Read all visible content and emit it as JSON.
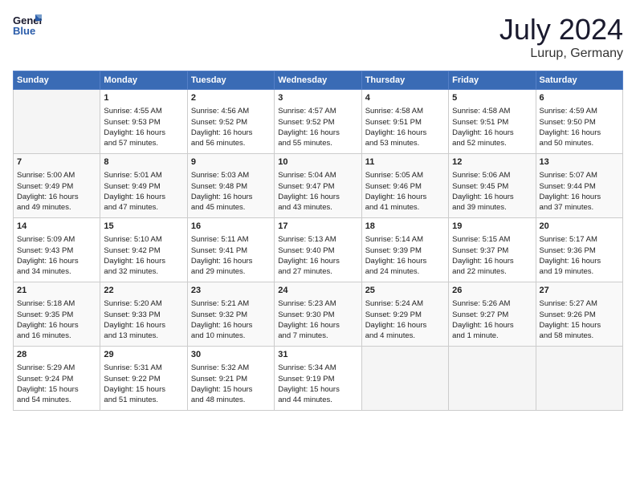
{
  "header": {
    "logo_line1": "General",
    "logo_line2": "Blue",
    "month_year": "July 2024",
    "location": "Lurup, Germany"
  },
  "days_of_week": [
    "Sunday",
    "Monday",
    "Tuesday",
    "Wednesday",
    "Thursday",
    "Friday",
    "Saturday"
  ],
  "weeks": [
    [
      {
        "day": "",
        "info": ""
      },
      {
        "day": "1",
        "info": "Sunrise: 4:55 AM\nSunset: 9:53 PM\nDaylight: 16 hours\nand 57 minutes."
      },
      {
        "day": "2",
        "info": "Sunrise: 4:56 AM\nSunset: 9:52 PM\nDaylight: 16 hours\nand 56 minutes."
      },
      {
        "day": "3",
        "info": "Sunrise: 4:57 AM\nSunset: 9:52 PM\nDaylight: 16 hours\nand 55 minutes."
      },
      {
        "day": "4",
        "info": "Sunrise: 4:58 AM\nSunset: 9:51 PM\nDaylight: 16 hours\nand 53 minutes."
      },
      {
        "day": "5",
        "info": "Sunrise: 4:58 AM\nSunset: 9:51 PM\nDaylight: 16 hours\nand 52 minutes."
      },
      {
        "day": "6",
        "info": "Sunrise: 4:59 AM\nSunset: 9:50 PM\nDaylight: 16 hours\nand 50 minutes."
      }
    ],
    [
      {
        "day": "7",
        "info": "Sunrise: 5:00 AM\nSunset: 9:49 PM\nDaylight: 16 hours\nand 49 minutes."
      },
      {
        "day": "8",
        "info": "Sunrise: 5:01 AM\nSunset: 9:49 PM\nDaylight: 16 hours\nand 47 minutes."
      },
      {
        "day": "9",
        "info": "Sunrise: 5:03 AM\nSunset: 9:48 PM\nDaylight: 16 hours\nand 45 minutes."
      },
      {
        "day": "10",
        "info": "Sunrise: 5:04 AM\nSunset: 9:47 PM\nDaylight: 16 hours\nand 43 minutes."
      },
      {
        "day": "11",
        "info": "Sunrise: 5:05 AM\nSunset: 9:46 PM\nDaylight: 16 hours\nand 41 minutes."
      },
      {
        "day": "12",
        "info": "Sunrise: 5:06 AM\nSunset: 9:45 PM\nDaylight: 16 hours\nand 39 minutes."
      },
      {
        "day": "13",
        "info": "Sunrise: 5:07 AM\nSunset: 9:44 PM\nDaylight: 16 hours\nand 37 minutes."
      }
    ],
    [
      {
        "day": "14",
        "info": "Sunrise: 5:09 AM\nSunset: 9:43 PM\nDaylight: 16 hours\nand 34 minutes."
      },
      {
        "day": "15",
        "info": "Sunrise: 5:10 AM\nSunset: 9:42 PM\nDaylight: 16 hours\nand 32 minutes."
      },
      {
        "day": "16",
        "info": "Sunrise: 5:11 AM\nSunset: 9:41 PM\nDaylight: 16 hours\nand 29 minutes."
      },
      {
        "day": "17",
        "info": "Sunrise: 5:13 AM\nSunset: 9:40 PM\nDaylight: 16 hours\nand 27 minutes."
      },
      {
        "day": "18",
        "info": "Sunrise: 5:14 AM\nSunset: 9:39 PM\nDaylight: 16 hours\nand 24 minutes."
      },
      {
        "day": "19",
        "info": "Sunrise: 5:15 AM\nSunset: 9:37 PM\nDaylight: 16 hours\nand 22 minutes."
      },
      {
        "day": "20",
        "info": "Sunrise: 5:17 AM\nSunset: 9:36 PM\nDaylight: 16 hours\nand 19 minutes."
      }
    ],
    [
      {
        "day": "21",
        "info": "Sunrise: 5:18 AM\nSunset: 9:35 PM\nDaylight: 16 hours\nand 16 minutes."
      },
      {
        "day": "22",
        "info": "Sunrise: 5:20 AM\nSunset: 9:33 PM\nDaylight: 16 hours\nand 13 minutes."
      },
      {
        "day": "23",
        "info": "Sunrise: 5:21 AM\nSunset: 9:32 PM\nDaylight: 16 hours\nand 10 minutes."
      },
      {
        "day": "24",
        "info": "Sunrise: 5:23 AM\nSunset: 9:30 PM\nDaylight: 16 hours\nand 7 minutes."
      },
      {
        "day": "25",
        "info": "Sunrise: 5:24 AM\nSunset: 9:29 PM\nDaylight: 16 hours\nand 4 minutes."
      },
      {
        "day": "26",
        "info": "Sunrise: 5:26 AM\nSunset: 9:27 PM\nDaylight: 16 hours\nand 1 minute."
      },
      {
        "day": "27",
        "info": "Sunrise: 5:27 AM\nSunset: 9:26 PM\nDaylight: 15 hours\nand 58 minutes."
      }
    ],
    [
      {
        "day": "28",
        "info": "Sunrise: 5:29 AM\nSunset: 9:24 PM\nDaylight: 15 hours\nand 54 minutes."
      },
      {
        "day": "29",
        "info": "Sunrise: 5:31 AM\nSunset: 9:22 PM\nDaylight: 15 hours\nand 51 minutes."
      },
      {
        "day": "30",
        "info": "Sunrise: 5:32 AM\nSunset: 9:21 PM\nDaylight: 15 hours\nand 48 minutes."
      },
      {
        "day": "31",
        "info": "Sunrise: 5:34 AM\nSunset: 9:19 PM\nDaylight: 15 hours\nand 44 minutes."
      },
      {
        "day": "",
        "info": ""
      },
      {
        "day": "",
        "info": ""
      },
      {
        "day": "",
        "info": ""
      }
    ]
  ]
}
